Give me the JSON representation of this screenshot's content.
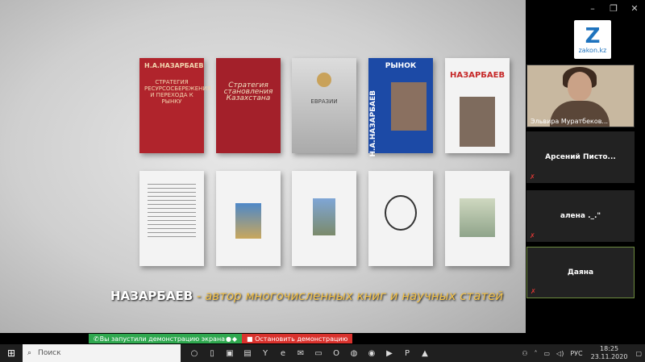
{
  "window": {
    "minimize": "–",
    "restore": "❐",
    "close": "✕"
  },
  "logo": {
    "letter": "Z",
    "site": "zakon.kz"
  },
  "books_row1": [
    {
      "title": "Н.А.НАЗАРБАЕВ",
      "subtitle": "СТРАТЕГИЯ РЕСУРСОСБЕРЕЖЕНИЯ И ПЕРЕХОДА К РЫНКУ",
      "style": "red"
    },
    {
      "title": "",
      "subtitle": "Стратегия становления Казахстана",
      "style": "red2"
    },
    {
      "title": "",
      "subtitle": "ЕВРАЗИИ",
      "style": "whitebk"
    },
    {
      "title": "РЫНОК",
      "subtitle": "Н.А.НАЗАРБАЕВ",
      "style": "blue"
    },
    {
      "title": "НАЗАРБАЕВ",
      "subtitle": "",
      "style": "whitebk"
    }
  ],
  "books_row2": [
    {
      "title": "",
      "subtitle": "",
      "style": "whitebk"
    },
    {
      "title": "",
      "subtitle": "",
      "style": "whitebk"
    },
    {
      "title": "",
      "subtitle": "",
      "style": "whitebk"
    },
    {
      "title": "",
      "subtitle": "",
      "style": "whitebk"
    },
    {
      "title": "",
      "subtitle": "",
      "style": "whitebk"
    }
  ],
  "caption": {
    "bold": "НАЗАРБАЕВ",
    "rest": " - автор многочисленных книг и научных статей"
  },
  "participants": {
    "video_name": "Эльвира Муратбеков...",
    "tile1": "Арсений  Писто...",
    "tile2": "алена ._.\"",
    "tile3": "Даяна"
  },
  "share": {
    "status": "Вы запустили демонстрацию экрана",
    "stop": "Остановить демонстрацию"
  },
  "taskbar": {
    "search_placeholder": "Поиск",
    "lang": "РУС",
    "time": "18:25",
    "date": "23.11.2020"
  }
}
